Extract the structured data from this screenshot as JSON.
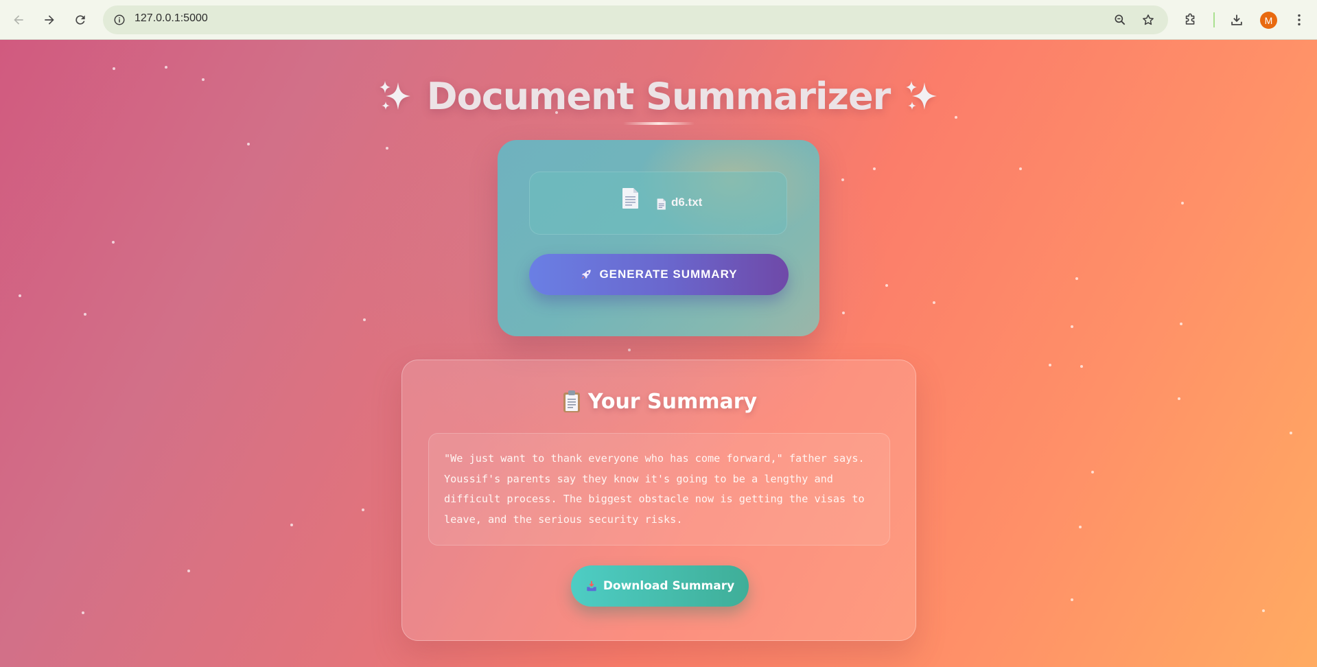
{
  "browser": {
    "url": "127.0.0.1:5000",
    "profile_initial": "M",
    "icons": {
      "back": "arrow-left-icon",
      "forward": "arrow-right-icon",
      "reload": "reload-icon",
      "site_info": "site-info-icon",
      "zoom": "zoom-icon",
      "bookmark": "star-icon",
      "extensions": "puzzle-icon",
      "downloads": "download-icon",
      "menu": "kebab-menu-icon"
    }
  },
  "app": {
    "title": "Document Summarizer",
    "title_icons": "sparkles-icon",
    "accent_colors": {
      "background_start": "#d15a7f",
      "background_end": "#ffab62",
      "generate_button": "#6a66cc",
      "download_button": "#4ecdc4"
    }
  },
  "upload": {
    "file_name": "d6.txt",
    "file_icon": "document-icon",
    "generate_label": "GENERATE SUMMARY",
    "generate_icon": "rocket-icon"
  },
  "summary": {
    "heading": "Your Summary",
    "heading_icon": "clipboard-icon",
    "lines": [
      "\"We just want to thank everyone who has come forward,\" father says.",
      "Youssif's parents say they know it's going to be a lengthy and",
      "difficult process. The biggest obstacle now is getting the visas to",
      "leave, and the serious security risks."
    ],
    "download_label": "Download Summary",
    "download_icon": "inbox-tray-icon"
  }
}
